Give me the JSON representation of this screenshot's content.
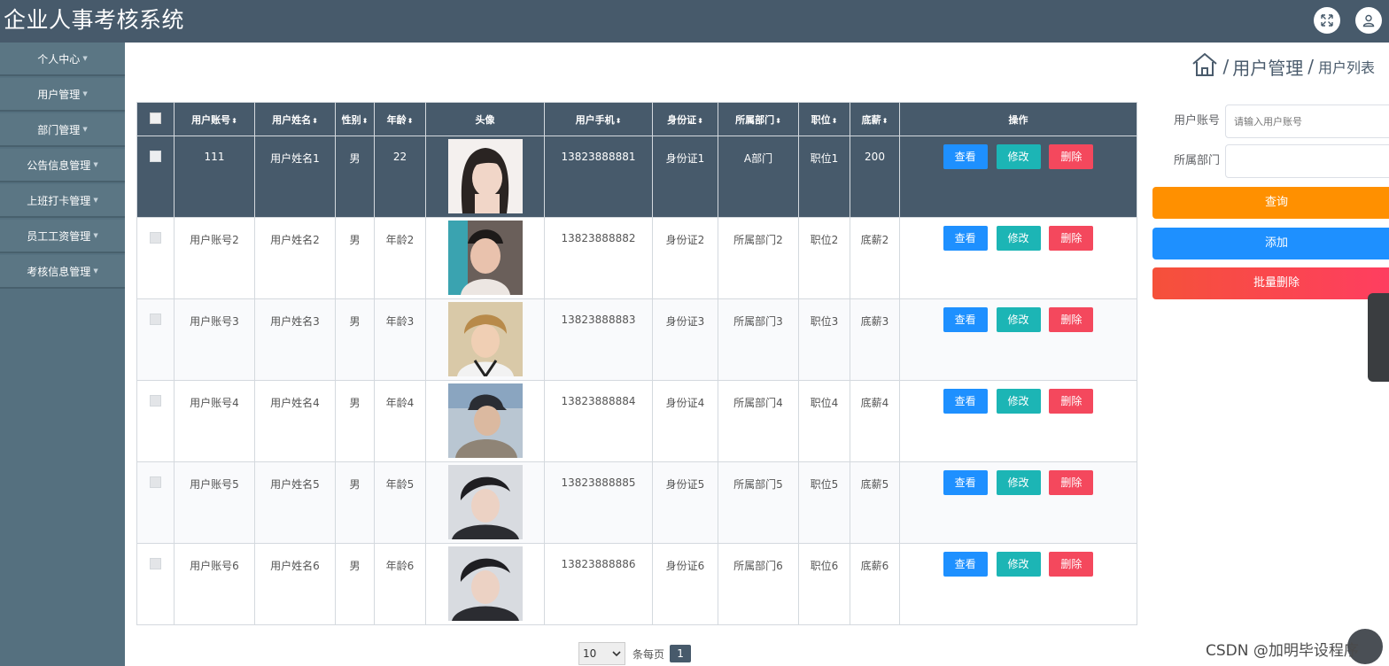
{
  "app": {
    "title": "企业人事考核系统"
  },
  "topbar": {
    "icons": [
      "fullscreen-icon",
      "user-icon"
    ]
  },
  "sidebar": {
    "items": [
      {
        "label": "个人中心"
      },
      {
        "label": "用户管理"
      },
      {
        "label": "部门管理"
      },
      {
        "label": "公告信息管理"
      },
      {
        "label": "上班打卡管理"
      },
      {
        "label": "员工工资管理"
      },
      {
        "label": "考核信息管理"
      }
    ]
  },
  "breadcrumb": {
    "sep": "/",
    "section": "用户管理",
    "page": "用户列表"
  },
  "table": {
    "sort_glyph": "⬍",
    "columns": [
      "用户账号",
      "用户姓名",
      "性别",
      "年龄",
      "头像",
      "用户手机",
      "身份证",
      "所属部门",
      "职位",
      "底薪",
      "操作"
    ],
    "rows": [
      {
        "account": "111",
        "name": "用户姓名1",
        "gender": "男",
        "age": "22",
        "phone": "13823888881",
        "id_card": "身份证1",
        "dept": "A部门",
        "position": "职位1",
        "salary": "200"
      },
      {
        "account": "用户账号2",
        "name": "用户姓名2",
        "gender": "男",
        "age": "年龄2",
        "phone": "13823888882",
        "id_card": "身份证2",
        "dept": "所属部门2",
        "position": "职位2",
        "salary": "底薪2"
      },
      {
        "account": "用户账号3",
        "name": "用户姓名3",
        "gender": "男",
        "age": "年龄3",
        "phone": "13823888883",
        "id_card": "身份证3",
        "dept": "所属部门3",
        "position": "职位3",
        "salary": "底薪3"
      },
      {
        "account": "用户账号4",
        "name": "用户姓名4",
        "gender": "男",
        "age": "年龄4",
        "phone": "13823888884",
        "id_card": "身份证4",
        "dept": "所属部门4",
        "position": "职位4",
        "salary": "底薪4"
      },
      {
        "account": "用户账号5",
        "name": "用户姓名5",
        "gender": "男",
        "age": "年龄5",
        "phone": "13823888885",
        "id_card": "身份证5",
        "dept": "所属部门5",
        "position": "职位5",
        "salary": "底薪5"
      },
      {
        "account": "用户账号6",
        "name": "用户姓名6",
        "gender": "男",
        "age": "年龄6",
        "phone": "13823888886",
        "id_card": "身份证6",
        "dept": "所属部门6",
        "position": "职位6",
        "salary": "底薪6"
      }
    ],
    "actions": {
      "view": "查看",
      "edit": "修改",
      "delete": "删除"
    }
  },
  "search": {
    "account_label": "用户账号",
    "account_placeholder": "请输入用户账号",
    "account_value": "",
    "dept_label": "所属部门",
    "dept_value": "",
    "query": "查询",
    "add": "添加",
    "batch_delete": "批量删除"
  },
  "pagination": {
    "page_size": "10",
    "per_page_label": "条每页",
    "current_page": "1"
  },
  "watermark": "CSDN @加明毕设程序",
  "colors": {
    "topbar": "#475a6b",
    "sidebar": "#55707f",
    "view_button": "#1e90ff",
    "edit_button": "#1cb5b5",
    "delete_button": "#f4485d",
    "query_button": "#ff9000",
    "batch_delete_button": "#ff3d62"
  }
}
